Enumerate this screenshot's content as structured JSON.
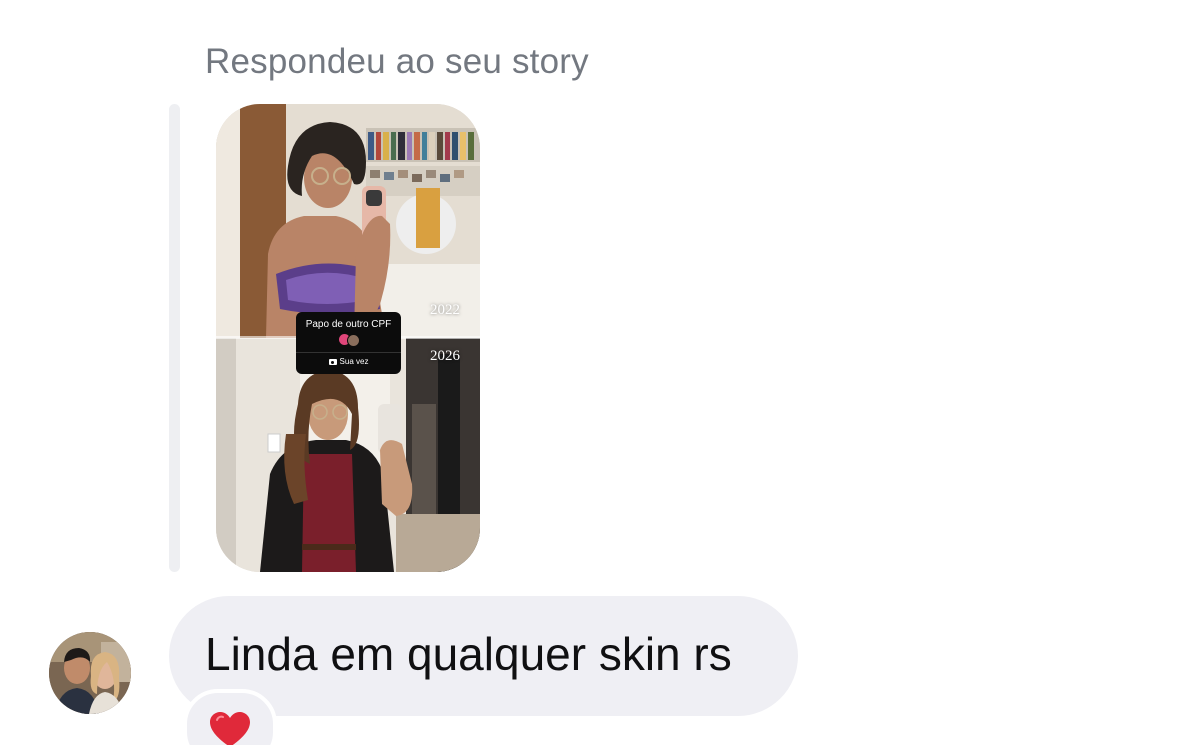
{
  "reply_context": {
    "label": "Respondeu ao seu story"
  },
  "story": {
    "year_top": "2022",
    "year_bottom": "2026",
    "sticker": {
      "title": "Papo de outro CPF",
      "action_label": "Sua vez",
      "action_icon": "camera-icon"
    }
  },
  "message": {
    "text": "Linda em qualquer skin rs",
    "reaction": "heart-emoji"
  },
  "colors": {
    "bubble_bg": "#efeff4",
    "secondary_text": "#737880",
    "primary_text": "#101012",
    "reaction_heart": "#e0293a"
  }
}
